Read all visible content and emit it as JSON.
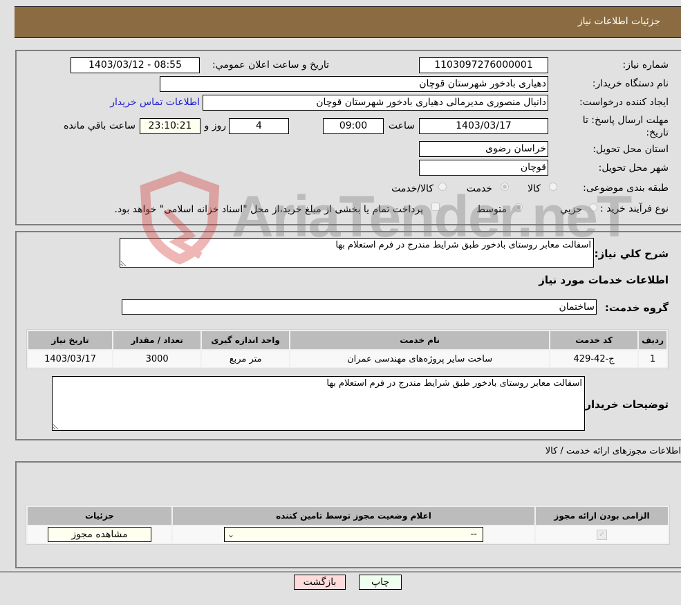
{
  "header": {
    "title": "جزئیات اطلاعات نیاز"
  },
  "details": {
    "need_number_label": "شماره نیاز:",
    "need_number": "1103097276000001",
    "announce_label": "تاریخ و ساعت اعلان عمومي:",
    "announce_value": "1403/03/12 - 08:55",
    "buyer_org_label": "نام دستگاه خریدار:",
    "buyer_org": "دهیاری بادخور شهرستان قوچان",
    "requester_label": "ایجاد کننده درخواست:",
    "requester": "دانیال منصوری مدیرمالی دهیاری بادخور شهرستان قوچان",
    "buyer_contact_link": "اطلاعات تماس خریدار",
    "deadline_label": "مهلت ارسال پاسخ: تا تاریخ:",
    "deadline_date": "1403/03/17",
    "time_label": "ساعت",
    "deadline_time": "09:00",
    "days_value": "4",
    "days_label": "روز و",
    "remaining_time": "23:10:21",
    "remaining_label": "ساعت باقي مانده",
    "province_label": "استان محل تحویل:",
    "province": "خراسان رضوی",
    "city_label": "شهر محل تحویل:",
    "city": "قوچان",
    "category_label": "طبقه بندی موضوعی:",
    "category_options": [
      {
        "label": "کالا",
        "checked": false
      },
      {
        "label": "خدمت",
        "checked": true
      },
      {
        "label": "کالا/خدمت",
        "checked": false
      }
    ],
    "process_label": "نوع فرآیند خرید :",
    "process_options": [
      {
        "label": "جزيي",
        "checked": false
      },
      {
        "label": "متوسط",
        "checked": true
      }
    ],
    "treasury_note": "پرداخت تمام یا بخشی از مبلغ خرید،از محل \"اسناد خزانه اسلامی\" خواهد بود."
  },
  "services": {
    "general_desc_label": "شرح کلي نیاز:",
    "general_desc": "اسفالت معابر روستای بادخور طبق شرایط مندرج در فرم استعلام بها",
    "section_title": "اطلاعات خدمات مورد نیاز",
    "group_label": "گروه خدمت:",
    "group_value": "ساختمان",
    "table": {
      "headers": [
        "ردیف",
        "کد خدمت",
        "نام خدمت",
        "واحد اندازه گیری",
        "تعداد / مقدار",
        "تاریخ نیاز"
      ],
      "rows": [
        [
          "1",
          "ج-42-429",
          "ساخت سایر پروژه‌های مهندسی عمران",
          "متر مربع",
          "3000",
          "1403/03/17"
        ]
      ]
    },
    "buyer_notes_label": "توضیحات خریدار:",
    "buyer_notes": "اسفالت معابر روستای بادخور طبق شرایط مندرج در فرم استعلام بها"
  },
  "permits": {
    "section_title": "اطلاعات مجوزهای ارائه خدمت / کالا",
    "headers": [
      "الزامی بودن ارائه مجوز",
      "اعلام وضعیت مجوز توسط تامین کننده",
      "جزئیات"
    ],
    "row": {
      "required": true,
      "status_selected": "--",
      "view_button": "مشاهده مجوز"
    }
  },
  "footer": {
    "print_button": "چاپ",
    "back_button": "بازگشت"
  },
  "watermark": {
    "text": "AriaTender.neT"
  },
  "colors": {
    "header_bg": "#8b6c42",
    "print_bg": "#efffef",
    "back_bg": "#ffdcdc",
    "link": "#1a1ad0"
  }
}
